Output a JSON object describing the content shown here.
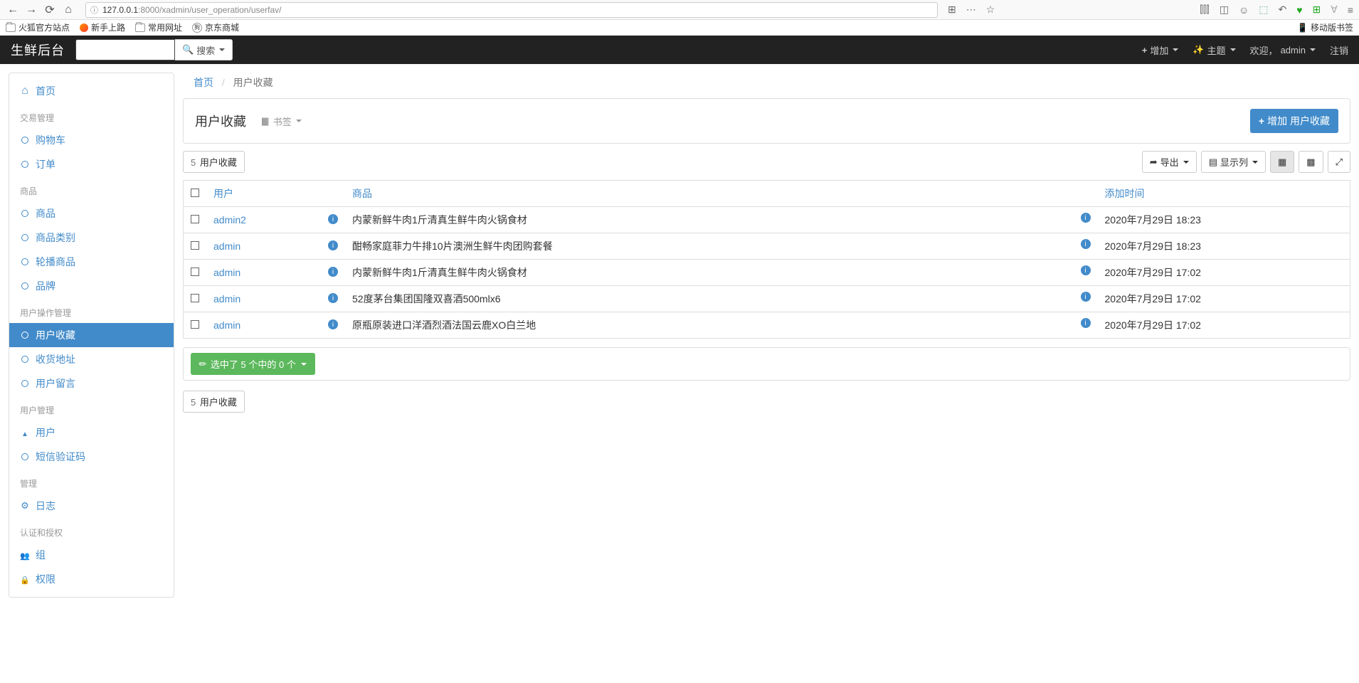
{
  "browser": {
    "url_host": "127.0.0.1",
    "url_port_path": ":8000/xadmin/user_operation/userfav/",
    "info_char": "ⓘ",
    "bookmarks": [
      "火狐官方站点",
      "新手上路",
      "常用网址",
      "京东商城"
    ],
    "mobile_label": "移动版书签"
  },
  "navbar": {
    "brand": "生鲜后台",
    "search_btn": "搜索",
    "add": "增加",
    "theme": "主题",
    "welcome": "欢迎，",
    "user": "admin",
    "logout": "注销"
  },
  "sidebar": {
    "home": "首页",
    "sections": {
      "trade": "交易管理",
      "goods": "商品",
      "userop": "用户操作管理",
      "usermgmt": "用户管理",
      "mgmt": "管理",
      "auth": "认证和授权"
    },
    "items": {
      "cart": "购物车",
      "order": "订单",
      "goods": "商品",
      "goodscat": "商品类别",
      "carousel": "轮播商品",
      "brand": "品牌",
      "userfav": "用户收藏",
      "useraddr": "收货地址",
      "usermsg": "用户留言",
      "user": "用户",
      "sms": "短信验证码",
      "log": "日志",
      "group": "组",
      "perm": "权限"
    }
  },
  "breadcrumb": {
    "home": "首页",
    "current": "用户收藏"
  },
  "header": {
    "title": "用户收藏",
    "bookmark": "书签",
    "add_btn": "增加 用户收藏"
  },
  "count": {
    "n": "5",
    "label": "用户收藏"
  },
  "toolbar": {
    "export": "导出",
    "columns": "显示列"
  },
  "table": {
    "cols": {
      "user": "用户",
      "goods": "商品",
      "time": "添加时间"
    },
    "rows": [
      {
        "user": "admin2",
        "goods": "内蒙新鲜牛肉1斤清真生鲜牛肉火锅食材",
        "time": "2020年7月29日 18:23"
      },
      {
        "user": "admin",
        "goods": "酣畅家庭菲力牛排10片澳洲生鲜牛肉团购套餐",
        "time": "2020年7月29日 18:23"
      },
      {
        "user": "admin",
        "goods": "内蒙新鲜牛肉1斤清真生鲜牛肉火锅食材",
        "time": "2020年7月29日 17:02"
      },
      {
        "user": "admin",
        "goods": "52度茅台集团国隆双喜酒500mlx6",
        "time": "2020年7月29日 17:02"
      },
      {
        "user": "admin",
        "goods": "原瓶原装进口洋酒烈酒法国云鹿XO白兰地",
        "time": "2020年7月29日 17:02"
      }
    ]
  },
  "action": {
    "label": "选中了 5 个中的 0 个"
  }
}
